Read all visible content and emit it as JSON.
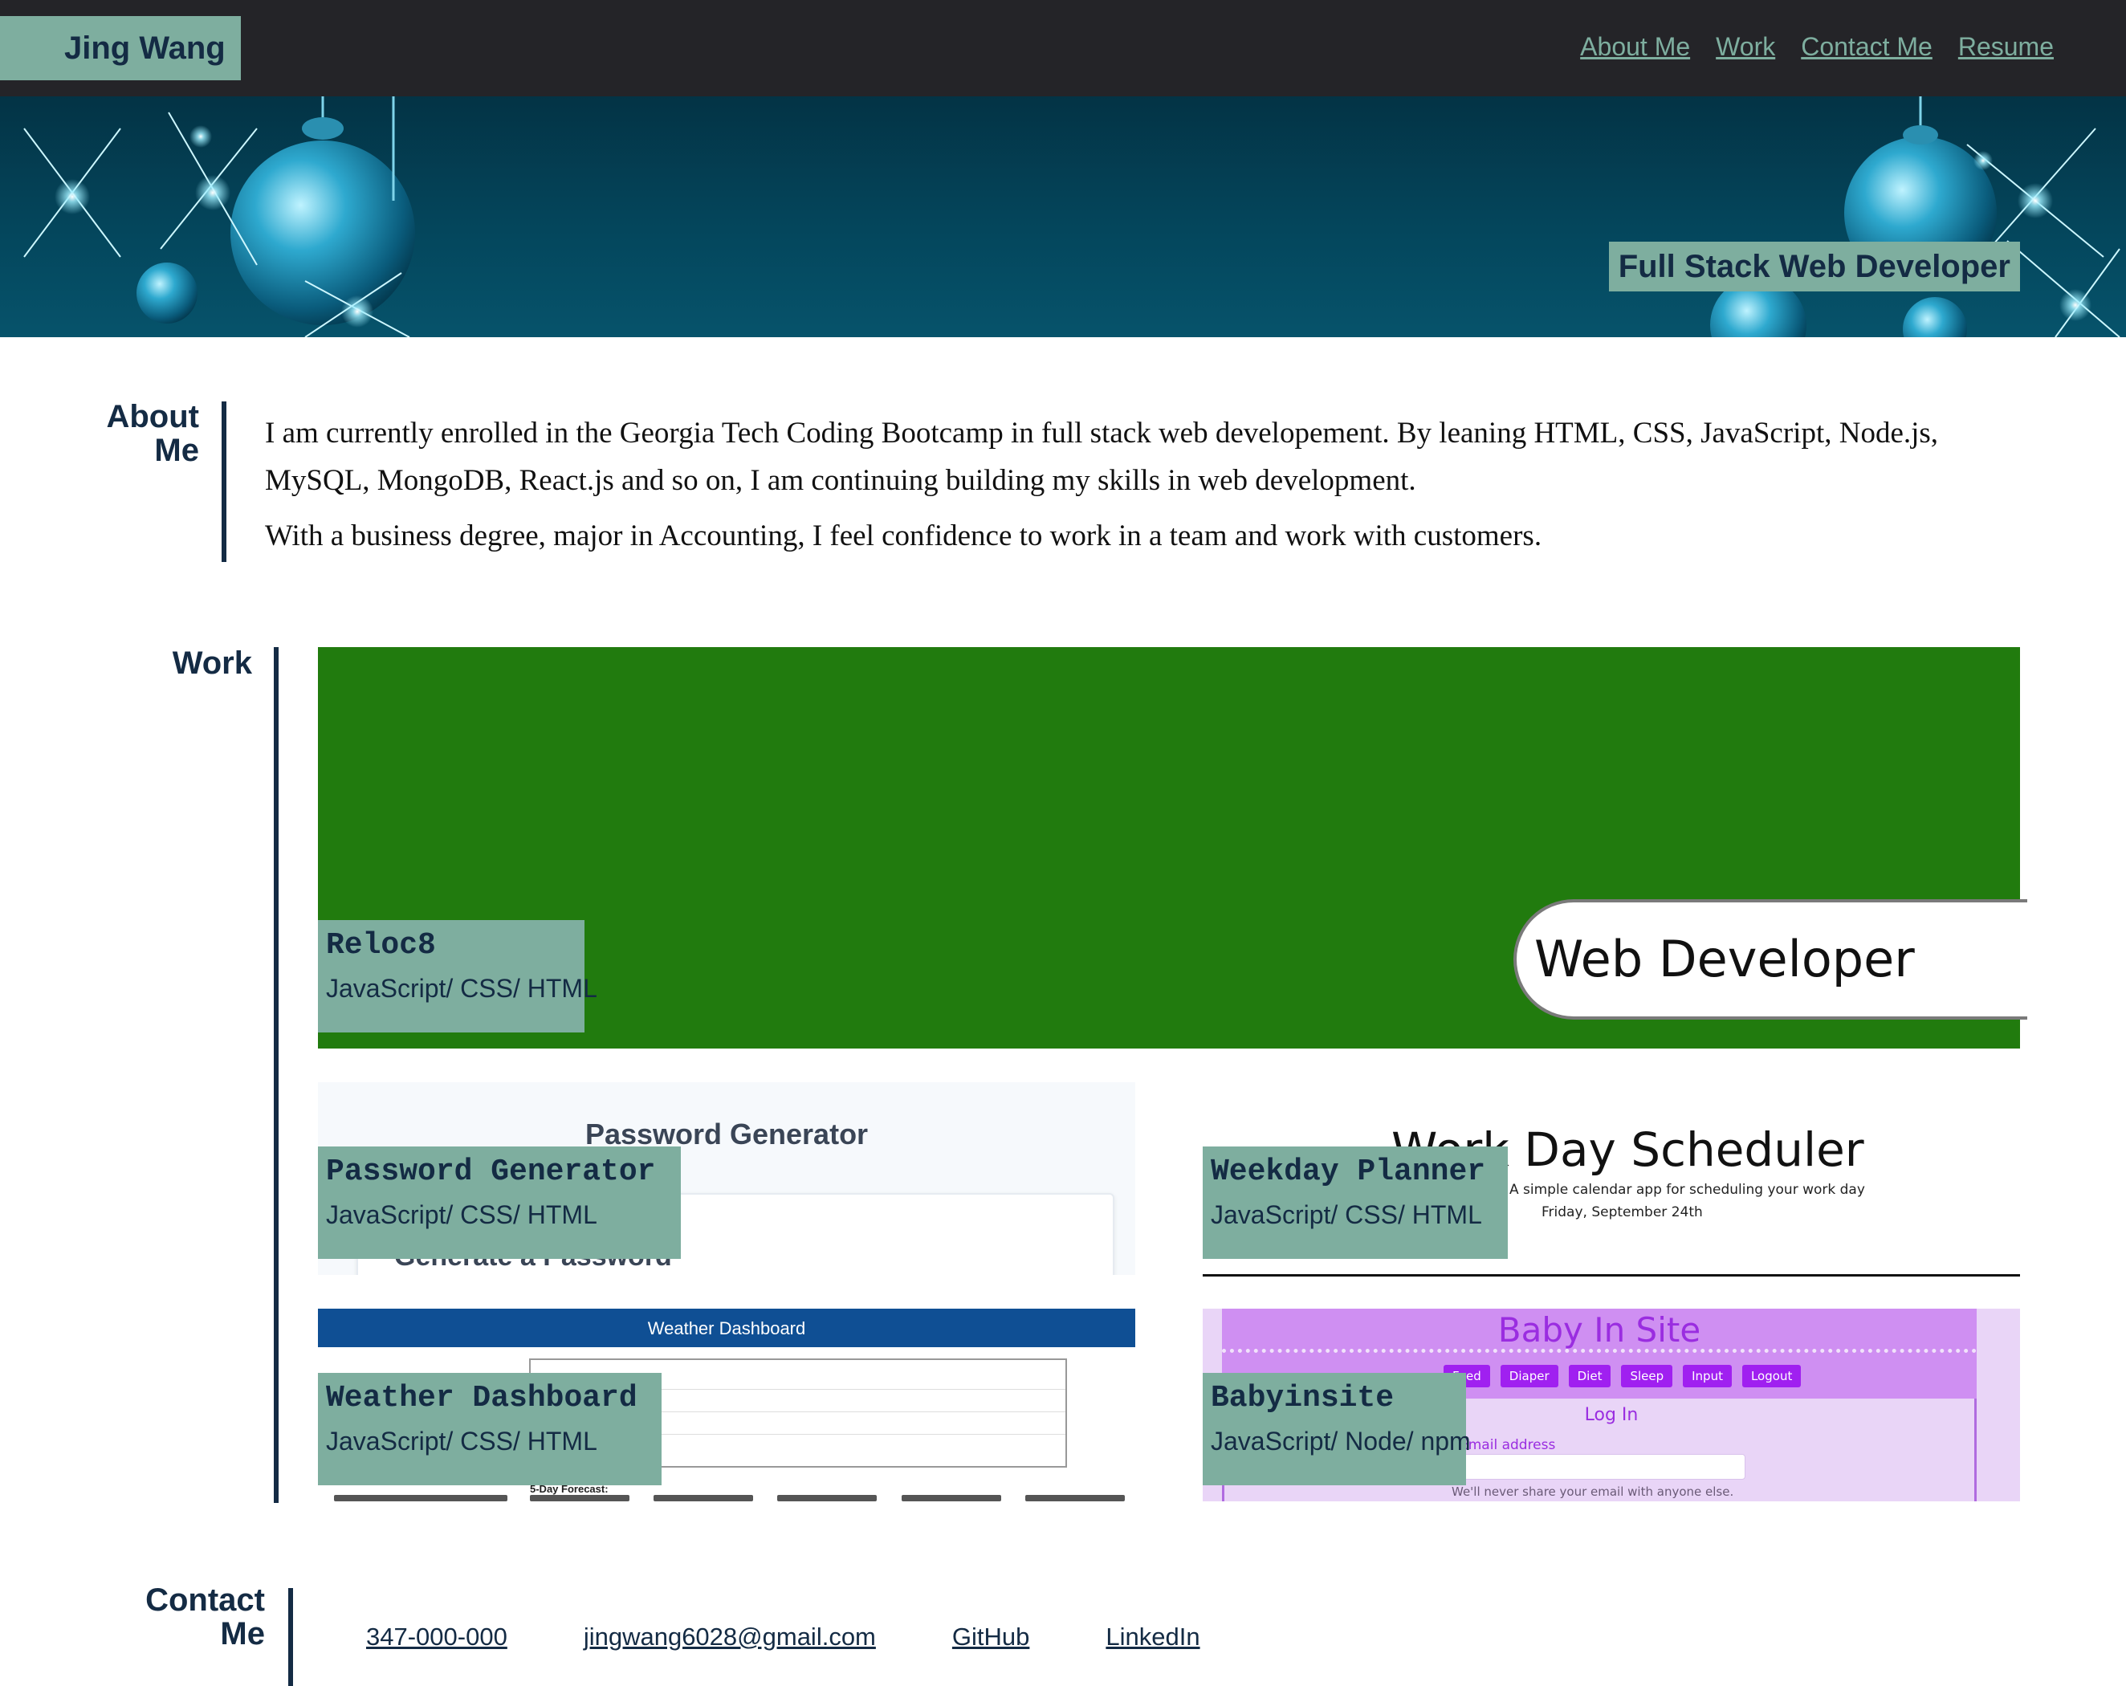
{
  "header": {
    "brand": "Jing Wang",
    "nav": [
      {
        "label": "About Me"
      },
      {
        "label": "Work"
      },
      {
        "label": "Contact Me"
      },
      {
        "label": "Resume"
      }
    ]
  },
  "hero": {
    "tagline": "Full Stack Web Developer"
  },
  "about": {
    "heading": "About Me",
    "paragraphs": [
      "I am currently enrolled in the Georgia Tech Coding Bootcamp in full stack web developement. By leaning HTML, CSS, JavaScript, Node.js, MySQL, MongoDB, React.js and so on, I am continuing building my skills in web development.",
      "With a business degree, major in Accounting, I feel confidence to work in a team and work with customers."
    ]
  },
  "work": {
    "heading": "Work",
    "projects": [
      {
        "title": "Reloc8",
        "tech": "JavaScript/ CSS/ HTML",
        "preview_text": "Web Developer"
      },
      {
        "title": "Password Generator",
        "tech": "JavaScript/ CSS/ HTML",
        "preview_title": "Password Generator",
        "preview_sub": "Generate a Password"
      },
      {
        "title": "Weekday Planner",
        "tech": "JavaScript/ CSS/ HTML",
        "preview_title": "Work Day Scheduler",
        "preview_sub": "A simple calendar app for scheduling your work day",
        "preview_date": "Friday, September 24th"
      },
      {
        "title": "Weather Dashboard",
        "tech": "JavaScript/ CSS/ HTML",
        "preview_title": "Weather Dashboard",
        "preview_forecast": "5-Day Forecast:"
      },
      {
        "title": "Babyinsite",
        "tech": "JavaScript/ Node/ npm",
        "preview_title": "Baby In Site",
        "preview_nav": [
          "Feed",
          "Diaper",
          "Diet",
          "Sleep",
          "Input",
          "Logout"
        ],
        "preview_login": "Log In",
        "preview_email": "Email address",
        "preview_note": "We'll never share your email with anyone else."
      }
    ]
  },
  "contact": {
    "heading": "Contact Me",
    "links": [
      {
        "label": "347-000-000"
      },
      {
        "label": "jingwang6028@gmail.com"
      },
      {
        "label": "GitHub"
      },
      {
        "label": "LinkedIn"
      }
    ]
  },
  "colors": {
    "accent": "#7eae9f",
    "navy": "#142b44",
    "header_bg": "#242428",
    "hero_bg": "#04465c",
    "reloc_green": "#217b0e"
  }
}
